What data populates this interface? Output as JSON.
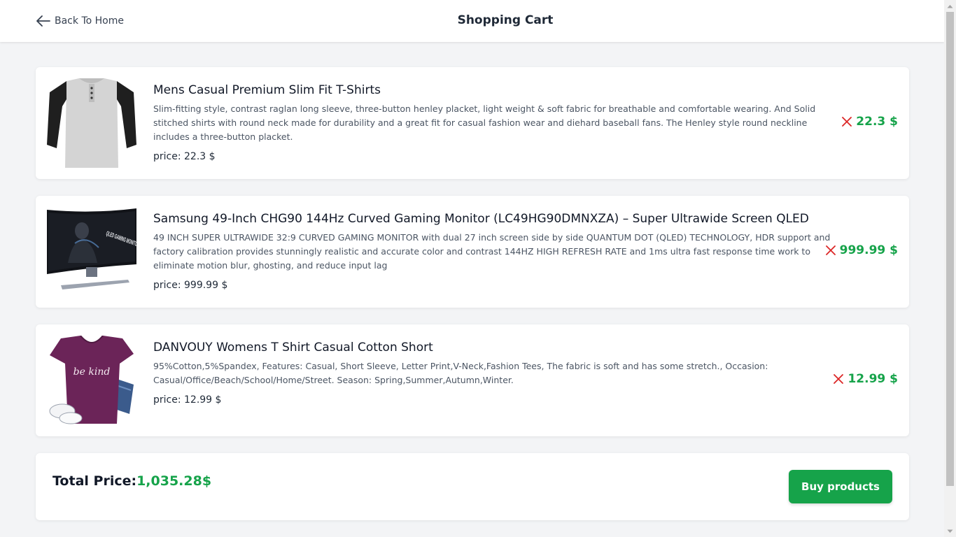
{
  "header": {
    "back_label": "Back To Home",
    "title": "Shopping Cart"
  },
  "cart": {
    "items": [
      {
        "title": "Mens Casual Premium Slim Fit T-Shirts",
        "description": "Slim-fitting style, contrast raglan long sleeve, three-button henley placket, light weight & soft fabric for breathable and comfortable wearing. And Solid stitched shirts with round neck made for durability and a great fit for casual fashion wear and diehard baseball fans. The Henley style round neckline includes a three-button placket.",
        "price_label": "price: 22.3 $",
        "total": "22.3 $",
        "image": "henley-shirt-image"
      },
      {
        "title": "Samsung 49-Inch CHG90 144Hz Curved Gaming Monitor (LC49HG90DMNXZA) – Super Ultrawide Screen QLED",
        "description": "49 INCH SUPER ULTRAWIDE 32:9 CURVED GAMING MONITOR with dual 27 inch screen side by side QUANTUM DOT (QLED) TECHNOLOGY, HDR support and factory calibration provides stunningly realistic and accurate color and contrast 144HZ HIGH REFRESH RATE and 1ms ultra fast response time work to eliminate motion blur, ghosting, and reduce input lag",
        "price_label": "price: 999.99 $",
        "total": "999.99 $",
        "image": "curved-monitor-image",
        "image_text": "QLED GAMING MONITOR"
      },
      {
        "title": "DANVOUY Womens T Shirt Casual Cotton Short",
        "description": "95%Cotton,5%Spandex, Features: Casual, Short Sleeve, Letter Print,V-Neck,Fashion Tees, The fabric is soft and has some stretch., Occasion: Casual/Office/Beach/School/Home/Street. Season: Spring,Summer,Autumn,Winter.",
        "price_label": "price: 12.99 $",
        "total": "12.99 $",
        "image": "womens-tshirt-image",
        "image_text": "be kind"
      }
    ]
  },
  "summary": {
    "total_label": "Total Price:",
    "total_value": "1,035.28$",
    "buy_label": "Buy products"
  },
  "colors": {
    "accent_green": "#16a34a",
    "remove_red": "#dc2626",
    "background": "#f3f4f6"
  },
  "icons": {
    "back": "arrow-left-icon",
    "remove": "close-icon"
  }
}
